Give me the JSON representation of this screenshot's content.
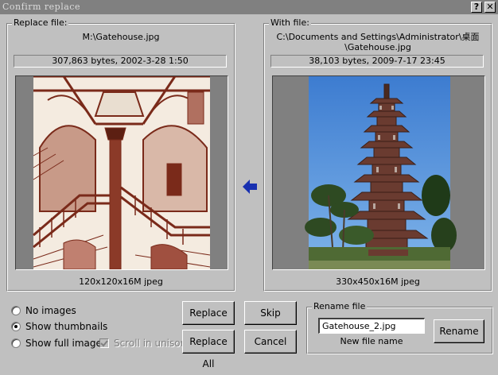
{
  "window": {
    "title": "Confirm replace",
    "help_glyph": "?",
    "close_glyph": "✕"
  },
  "left_panel": {
    "group_label": "Replace file:",
    "filename": "M:\\Gatehouse.jpg",
    "info": "307,863 bytes, 2002-3-28 1:50",
    "format": "120x120x16M jpeg",
    "image_name": "staircase-etching-image"
  },
  "right_panel": {
    "group_label": "With file:",
    "path_line1": "C:\\Documents and Settings\\Administrator\\桌面",
    "path_line2": "\\Gatehouse.jpg",
    "info": "38,103 bytes, 2009-7-17 23:45",
    "format": "330x450x16M jpeg",
    "image_name": "pagoda-photo-image"
  },
  "arrow": {
    "icon": "left-arrow-icon",
    "color": "#1830b0"
  },
  "options": {
    "no_images": "No images",
    "show_thumbnails": "Show thumbnails",
    "show_full_images": "Show full images",
    "scroll_in_unison": "Scroll in unison",
    "selected": "show_thumbnails",
    "scroll_in_unison_checked": true,
    "scroll_in_unison_enabled": false
  },
  "buttons": {
    "replace": "Replace",
    "replace_all": "Replace All",
    "skip": "Skip",
    "cancel": "Cancel",
    "rename": "Rename"
  },
  "rename": {
    "group_label": "Rename file",
    "value": "Gatehouse_2.jpg",
    "caption": "New file name"
  }
}
